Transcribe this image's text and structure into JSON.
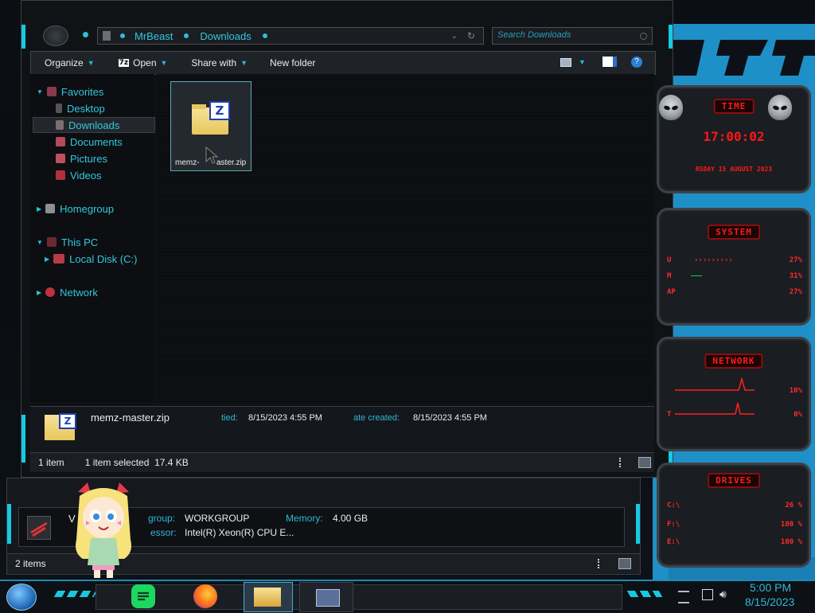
{
  "explorer": {
    "breadcrumb": [
      "MrBeast",
      "Downloads"
    ],
    "search_placeholder": "Search Downloads",
    "toolbar": {
      "organize": "Organize",
      "open": "Open",
      "open_badge": "7z",
      "share_with": "Share with",
      "new_folder": "New folder"
    },
    "nav": {
      "favorites": "Favorites",
      "desktop": "Desktop",
      "downloads": "Downloads",
      "documents": "Documents",
      "pictures": "Pictures",
      "videos": "Videos",
      "homegroup": "Homegroup",
      "this_pc": "This PC",
      "local_disk": "Local Disk (C:)",
      "network": "Network"
    },
    "file": {
      "name": "memz-master.zip",
      "name_trunc_a": "memz-",
      "name_trunc_b": "aster.zip",
      "zip_letter": "Z"
    },
    "details": {
      "name": "memz-master.zip",
      "modified_label": "tied:",
      "modified": "8/15/2023 4:55 PM",
      "created_label": "ate created:",
      "created": "8/15/2023 4:55 PM"
    },
    "status": {
      "items": "1 item",
      "selected": "1 item selected  17.4 KB"
    }
  },
  "back_window": {
    "workgroup_label": "group:",
    "workgroup": "WORKGROUP",
    "memory_label": "Memory:",
    "memory": "4.00 GB",
    "processor_label": "essor:",
    "processor": "Intel(R) Xeon(R) CPU E...",
    "v_letter": "V",
    "status_items": "2 items"
  },
  "gadget": {
    "time_title": "TIME",
    "time": "17:00:02",
    "date": "RSDAY 15 AUGUST 2023",
    "system_title": "SYSTEM",
    "system_rows": [
      {
        "label": "U",
        "value": "27%"
      },
      {
        "label": "M",
        "value": "31%"
      },
      {
        "label": "AP",
        "value": "27%"
      }
    ],
    "network_title": "NETWORK",
    "network_rows": [
      {
        "label": "",
        "value": "10%"
      },
      {
        "label": "T",
        "value": "0%"
      }
    ],
    "drives_title": "DRIVES",
    "drives_rows": [
      {
        "label": "C:\\",
        "value": "26 %"
      },
      {
        "label": "F:\\",
        "value": "100 %"
      },
      {
        "label": "E:\\",
        "value": "100 %"
      }
    ]
  },
  "taskbar": {
    "time": "5:00 PM",
    "date": "8/15/2023",
    "apps": [
      "start-orb",
      "spotify",
      "firefox",
      "file-explorer",
      "control-panel"
    ]
  },
  "colors": {
    "accent_cyan": "#17c9e0",
    "nav_text": "#32c8dd",
    "gadget_red": "#ff1a1a",
    "wallpaper_blue": "#1f8fc8"
  }
}
